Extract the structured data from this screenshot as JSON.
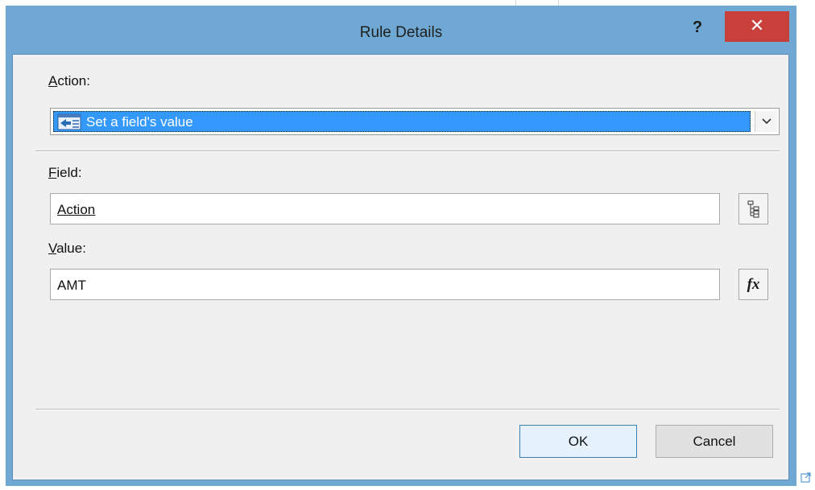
{
  "dialog": {
    "title": "Rule Details",
    "help_glyph": "?",
    "close_glyph": "✕"
  },
  "action": {
    "label_accel": "A",
    "label_rest": "ction:",
    "selected_value": "Set a field's value",
    "icon": "set-field-value-icon"
  },
  "field": {
    "label_accel": "F",
    "label_rest": "ield:",
    "value": "Action",
    "picker_icon": "field-tree-icon"
  },
  "value": {
    "label_accel": "V",
    "label_rest": "alue:",
    "value": "AMT",
    "formula_label": "fx"
  },
  "buttons": {
    "ok": "OK",
    "cancel": "Cancel"
  },
  "colors": {
    "title_bar": "#6fa9d3",
    "close_button": "#c9403a",
    "selection": "#3399ff"
  }
}
